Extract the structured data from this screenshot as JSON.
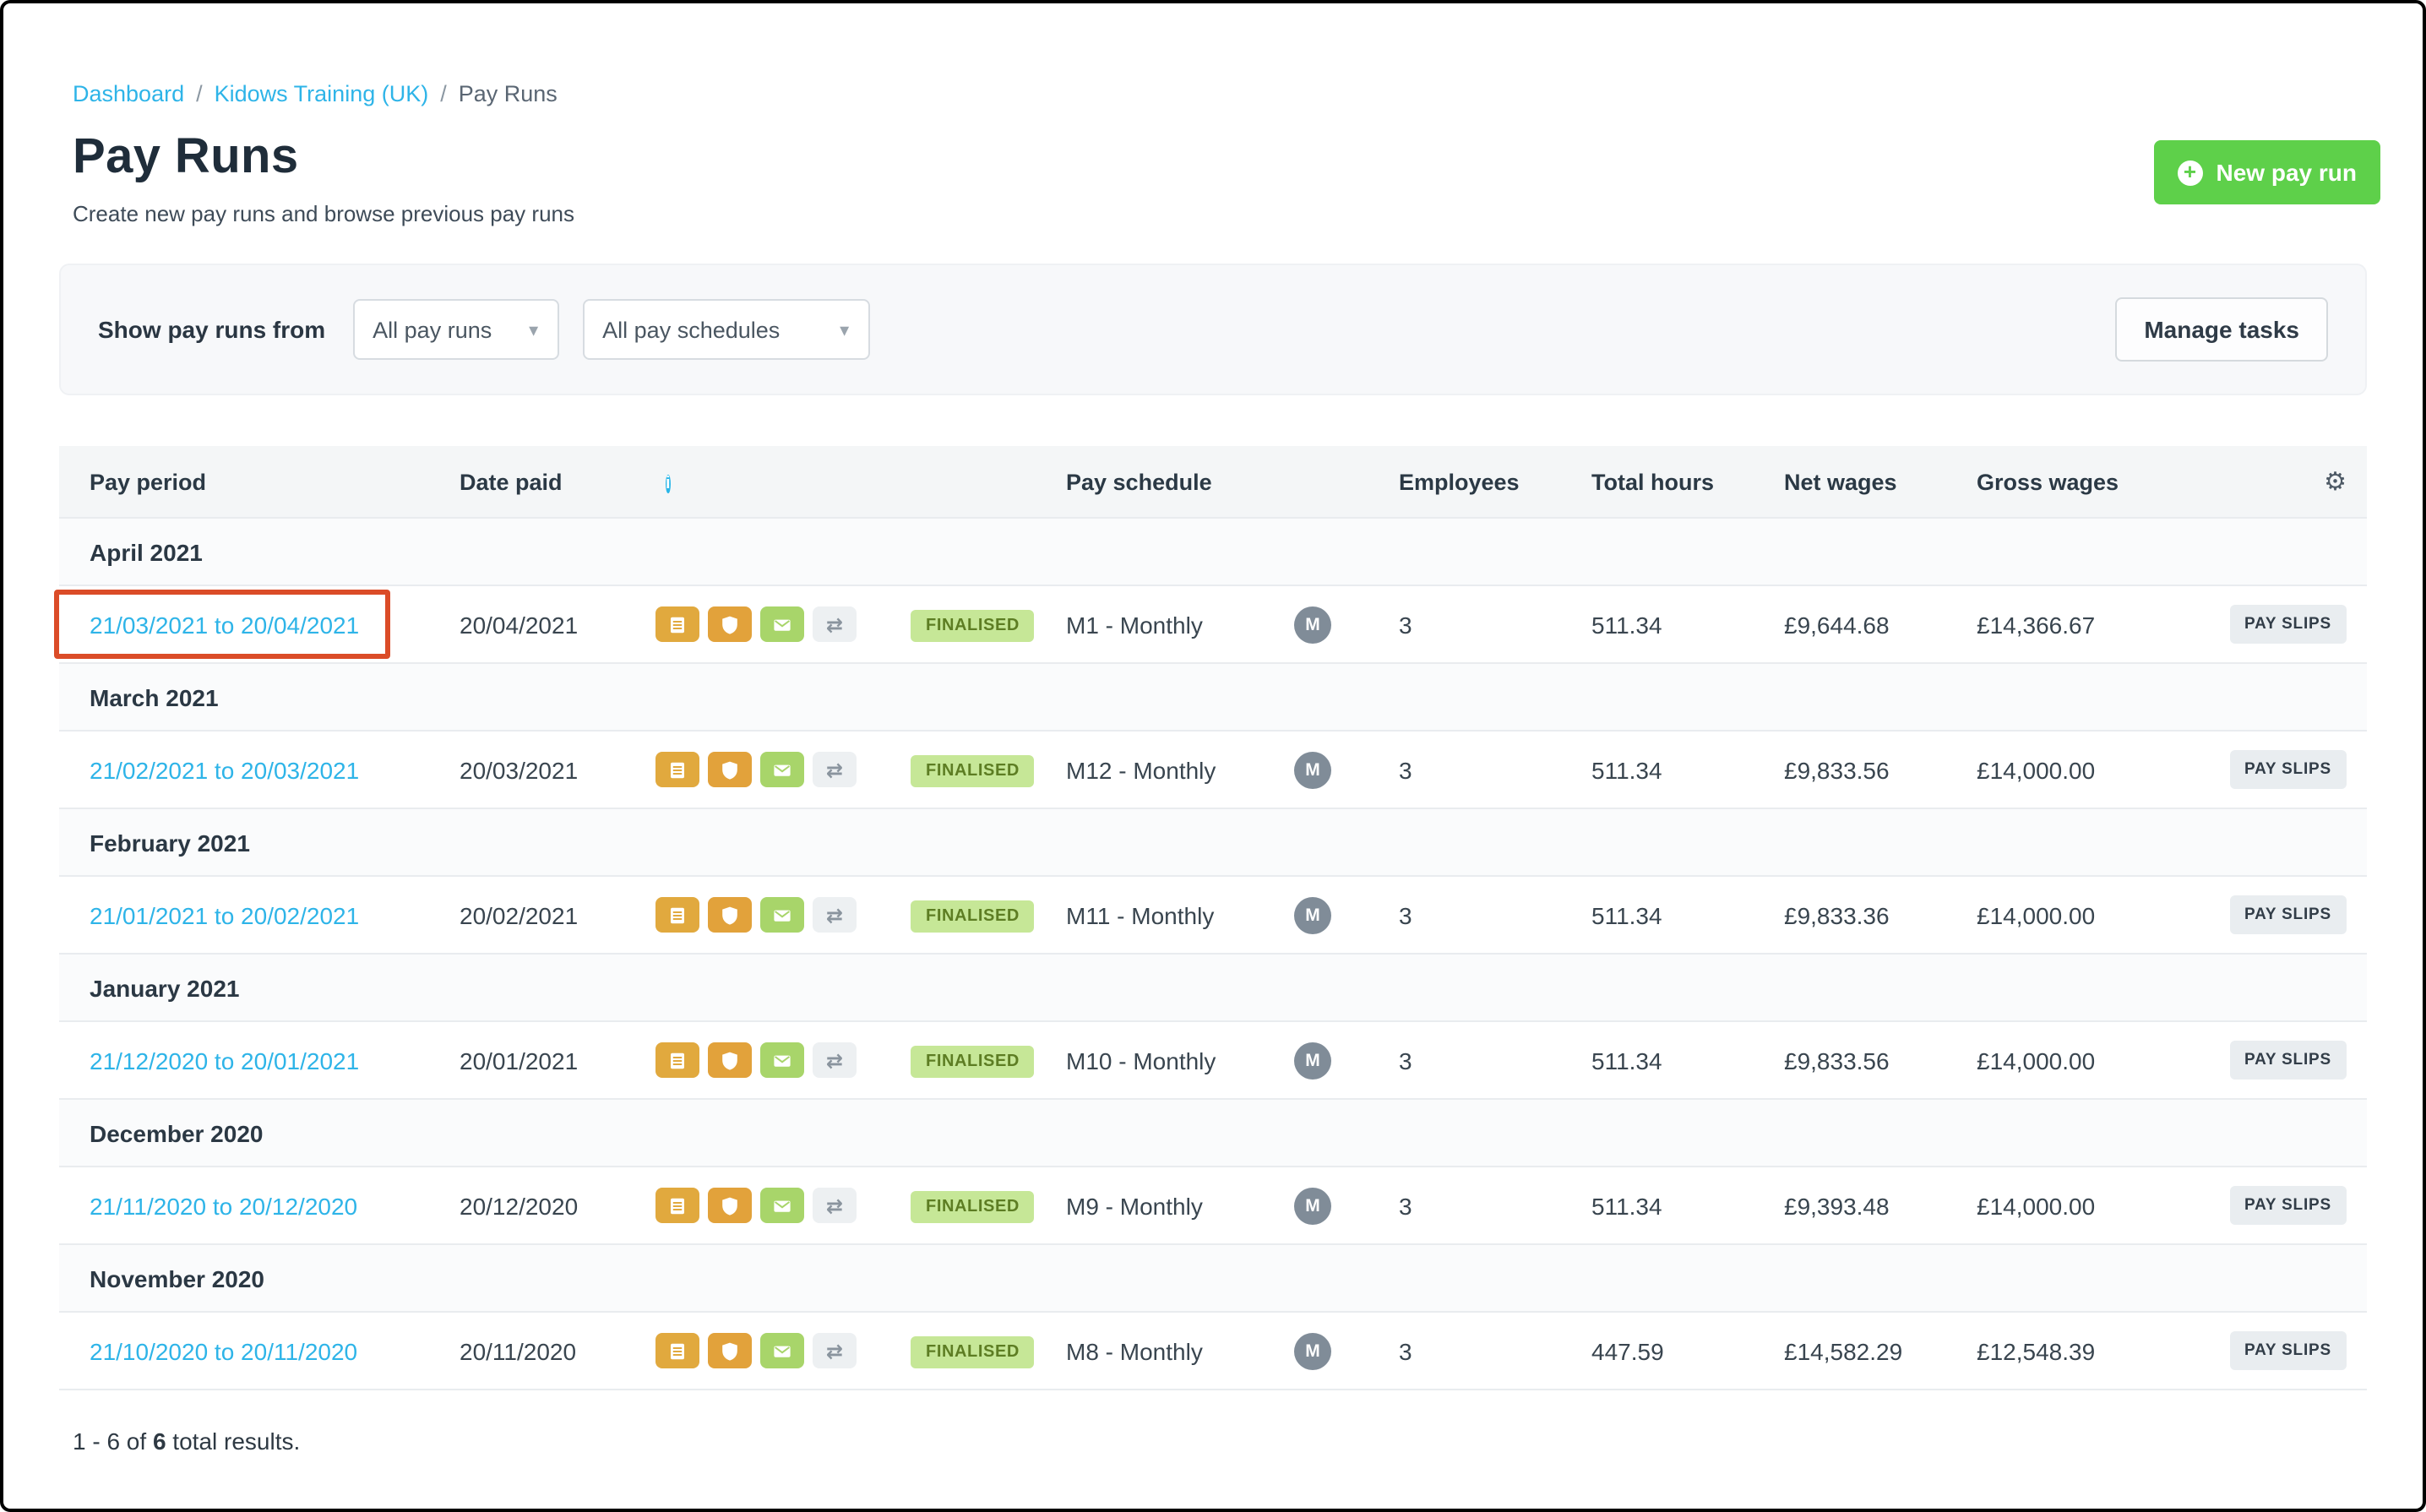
{
  "breadcrumb": {
    "items": [
      "Dashboard",
      "Kidows Training (UK)",
      "Pay Runs"
    ],
    "separator": "/"
  },
  "page": {
    "title": "Pay Runs",
    "subtitle": "Create new pay runs and browse previous pay runs"
  },
  "actions": {
    "new_pay_run": "New pay run",
    "manage_tasks": "Manage tasks"
  },
  "filters": {
    "label": "Show pay runs from",
    "pay_runs_value": "All pay runs",
    "pay_schedules_value": "All pay schedules"
  },
  "table": {
    "columns": {
      "pay_period": "Pay period",
      "date_paid": "Date paid",
      "pay_schedule": "Pay schedule",
      "employees": "Employees",
      "total_hours": "Total hours",
      "net_wages": "Net wages",
      "gross_wages": "Gross wages"
    },
    "payslips_label": "PAY SLIPS",
    "row_icons": [
      "journal-icon",
      "shield-icon",
      "email-icon",
      "sync-icon"
    ],
    "groups": [
      {
        "month": "April 2021",
        "rows": [
          {
            "pay_period": "21/03/2021 to 20/04/2021",
            "date_paid": "20/04/2021",
            "status": "FINALISED",
            "pay_schedule": "M1 - Monthly",
            "frequency_badge": "M",
            "employees": "3",
            "total_hours": "511.34",
            "net_wages": "£9,644.68",
            "gross_wages": "£14,366.67"
          }
        ]
      },
      {
        "month": "March 2021",
        "rows": [
          {
            "pay_period": "21/02/2021 to 20/03/2021",
            "date_paid": "20/03/2021",
            "status": "FINALISED",
            "pay_schedule": "M12 - Monthly",
            "frequency_badge": "M",
            "employees": "3",
            "total_hours": "511.34",
            "net_wages": "£9,833.56",
            "gross_wages": "£14,000.00"
          }
        ]
      },
      {
        "month": "February 2021",
        "rows": [
          {
            "pay_period": "21/01/2021 to 20/02/2021",
            "date_paid": "20/02/2021",
            "status": "FINALISED",
            "pay_schedule": "M11 - Monthly",
            "frequency_badge": "M",
            "employees": "3",
            "total_hours": "511.34",
            "net_wages": "£9,833.36",
            "gross_wages": "£14,000.00"
          }
        ]
      },
      {
        "month": "January 2021",
        "rows": [
          {
            "pay_period": "21/12/2020 to 20/01/2021",
            "date_paid": "20/01/2021",
            "status": "FINALISED",
            "pay_schedule": "M10 - Monthly",
            "frequency_badge": "M",
            "employees": "3",
            "total_hours": "511.34",
            "net_wages": "£9,833.56",
            "gross_wages": "£14,000.00"
          }
        ]
      },
      {
        "month": "December 2020",
        "rows": [
          {
            "pay_period": "21/11/2020 to 20/12/2020",
            "date_paid": "20/12/2020",
            "status": "FINALISED",
            "pay_schedule": "M9 - Monthly",
            "frequency_badge": "M",
            "employees": "3",
            "total_hours": "511.34",
            "net_wages": "£9,393.48",
            "gross_wages": "£14,000.00"
          }
        ]
      },
      {
        "month": "November 2020",
        "rows": [
          {
            "pay_period": "21/10/2020 to 20/11/2020",
            "date_paid": "20/11/2020",
            "status": "FINALISED",
            "pay_schedule": "M8 - Monthly",
            "frequency_badge": "M",
            "employees": "3",
            "total_hours": "447.59",
            "net_wages": "£14,582.29",
            "gross_wages": "£12,548.39"
          }
        ]
      }
    ]
  },
  "footer": {
    "prefix": "1 - 6 of ",
    "total": "6",
    "suffix": " total results."
  },
  "colors": {
    "accent_link": "#2eb4e8",
    "primary_green": "#5ed04a",
    "status_finalised_bg": "#c6e797",
    "status_finalised_text": "#5d7d23",
    "annotation": "#db4c28"
  }
}
